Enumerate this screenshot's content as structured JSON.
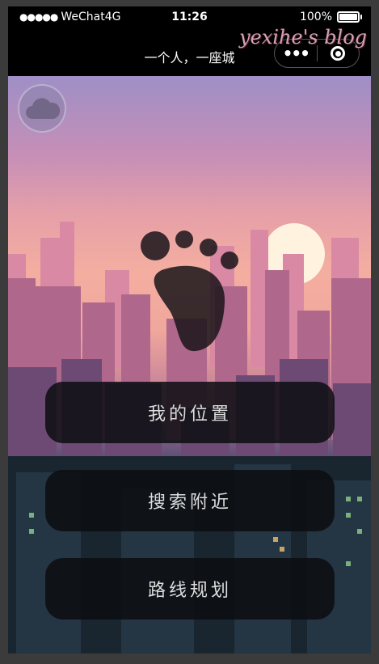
{
  "status_bar": {
    "signal": "●●●●●",
    "carrier": "WeChat4G",
    "time": "11:26",
    "battery": "100%"
  },
  "nav": {
    "title": "一个人，一座城",
    "more_label": "•••"
  },
  "watermark": "yexihe's blog",
  "menu": {
    "my_location": "我的位置",
    "search_nearby": "搜索附近",
    "route_planning": "路线规划"
  },
  "colors": {
    "sky_top": "#9f8fc6",
    "sky_mid": "#f4aea0",
    "city_dark": "#141d26",
    "button_bg": "#0c0e12"
  }
}
